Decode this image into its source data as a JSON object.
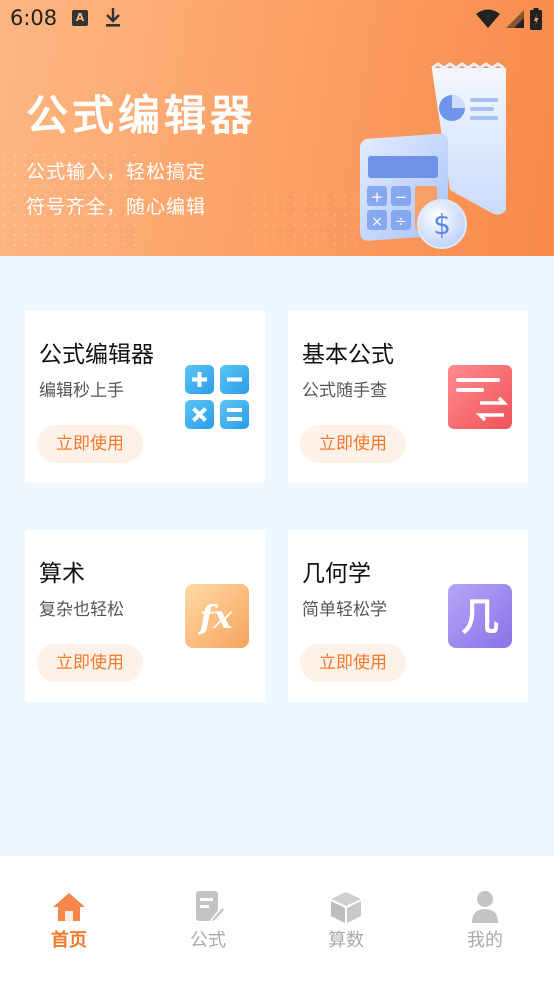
{
  "status_bar": {
    "time": "6:08"
  },
  "hero": {
    "title": "公式编辑器",
    "subtitle_1": "公式输入，轻松搞定",
    "subtitle_2": "符号齐全，随心编辑"
  },
  "cards": [
    {
      "title": "公式编辑器",
      "subtitle": "编辑秒上手",
      "button": "立即使用",
      "icon": "calculator-ops-icon"
    },
    {
      "title": "基本公式",
      "subtitle": "公式随手查",
      "button": "立即使用",
      "icon": "formula-list-icon"
    },
    {
      "title": "算术",
      "subtitle": "复杂也轻松",
      "button": "立即使用",
      "icon": "fx-icon"
    },
    {
      "title": "几何学",
      "subtitle": "简单轻松学",
      "button": "立即使用",
      "icon": "geometry-icon"
    }
  ],
  "geometry_icon_char": "几",
  "fx_icon_text": "fx",
  "bottom_nav": [
    {
      "label": "首页",
      "icon": "home-icon",
      "active": true
    },
    {
      "label": "公式",
      "icon": "formula-doc-icon",
      "active": false
    },
    {
      "label": "算数",
      "icon": "cube-icon",
      "active": false
    },
    {
      "label": "我的",
      "icon": "user-icon",
      "active": false
    }
  ],
  "colors": {
    "accent": "#f27a2e",
    "hero_start": "#fdb783",
    "hero_end": "#f9894a",
    "page_bg": "#eef6fe"
  }
}
